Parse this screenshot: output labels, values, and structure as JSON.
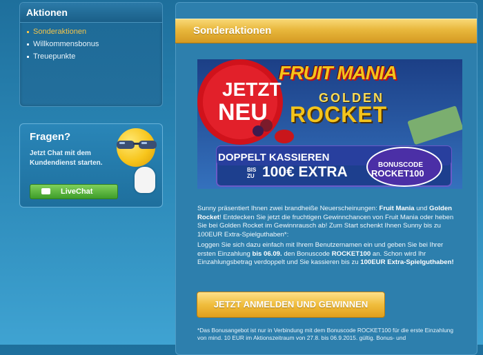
{
  "sidebar": {
    "title": "Aktionen",
    "items": [
      {
        "label": "Sonderaktionen",
        "active": true
      },
      {
        "label": "Willkommensbonus",
        "active": false
      },
      {
        "label": "Treuepunkte",
        "active": false
      }
    ]
  },
  "chat": {
    "title": "Fragen?",
    "text": "Jetzt Chat mit dem Kundendienst starten.",
    "button_label": "LiveChat",
    "icons": [
      "smiley-sunglasses-icon",
      "chat-bubble-icon"
    ]
  },
  "main": {
    "title": "Sonderaktionen",
    "banner": {
      "jetzt": "JETZT",
      "neu": "NEU",
      "game1": "FRUIT MANIA",
      "golden": "GOLDEN",
      "rocket": "ROCKET",
      "offer_line1": "DOPPELT KASSIEREN",
      "bis": "BIS",
      "zu": "ZU",
      "offer_line2": "100€ EXTRA",
      "code_label": "BONUSCODE",
      "code_value": "ROCKET100"
    },
    "paragraph1_a": "Sunny präsentiert Ihnen zwei brandheiße Neuerscheinungen: ",
    "paragraph1_b": "Fruit Mania",
    "paragraph1_c": " und ",
    "paragraph1_d": "Golden Rocket",
    "paragraph1_e": "! Entdecken Sie jetzt die fruchtigen Gewinnchancen von Fruit Mania oder heben Sie bei Golden Rocket im Gewinnrausch ab! Zum Start schenkt Ihnen Sunny bis zu 100EUR Extra-Spielguthaben*:",
    "paragraph2_a": "Loggen Sie sich dazu einfach mit Ihrem Benutzernamen ein und geben Sie bei Ihrer ersten Einzahlung ",
    "paragraph2_b": "bis 06.09.",
    "paragraph2_c": " den Bonuscode ",
    "paragraph2_d": "ROCKET100",
    "paragraph2_e": " an. Schon wird Ihr Einzahlungsbetrag verdoppelt und Sie kassieren bis zu ",
    "paragraph2_f": "100EUR Extra-Spielguthaben!",
    "cta_label": "JETZT ANMELDEN UND GEWINNEN",
    "fine_print": "*Das Bonusangebot ist nur in Verbindung mit dem Bonuscode ROCKET100 für die erste Einzahlung von mind. 10 EUR im Aktionszeitraum von 27.8. bis 06.9.2015. gültig. Bonus- und"
  },
  "colors": {
    "accent_gold": "#f0bd3d",
    "active_nav": "#f2c44b",
    "live_green": "#3e9d2a",
    "banner_red": "#d0121b"
  }
}
